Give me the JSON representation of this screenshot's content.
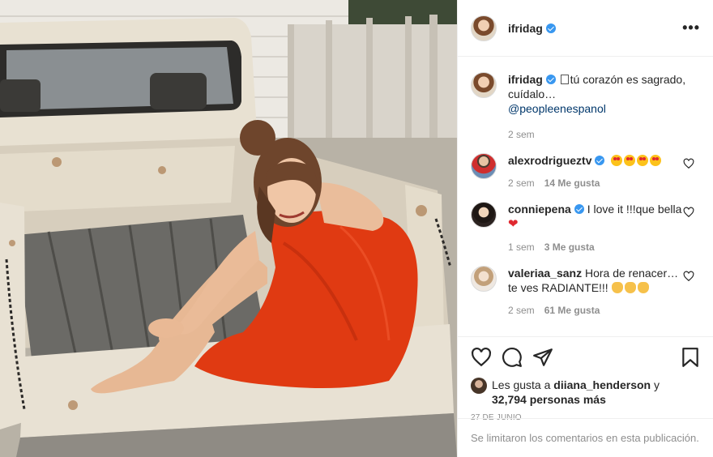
{
  "post": {
    "author": "ifridag",
    "author_verified": true,
    "more_icon": "more-horizontal-icon"
  },
  "caption": {
    "username": "ifridag",
    "text": "tú corazón es sagrado, cuídalo…",
    "mention": "@peopleenespanol",
    "time": "2 sem"
  },
  "comments": [
    {
      "username": "alexrodrigueztv",
      "verified": true,
      "text": "",
      "emoji": "star-struck x4",
      "time": "2 sem",
      "likes": "14 Me gusta"
    },
    {
      "username": "conniepena",
      "verified": true,
      "text": "I love it !!!que bella",
      "emoji": "red-heart",
      "time": "1 sem",
      "likes": "3 Me gusta"
    },
    {
      "username": "valeriaa_sanz",
      "verified": false,
      "text": "Hora de renacer… te ves RADIANTE!!!",
      "emoji": "clapping-hands x3",
      "time": "2 sem",
      "likes": "61 Me gusta"
    }
  ],
  "actions": {
    "like_icon": "heart-icon",
    "comment_icon": "comment-icon",
    "share_icon": "share-icon",
    "save_icon": "bookmark-icon"
  },
  "likes": {
    "prefix": "Les gusta a",
    "user": "diiana_henderson",
    "joiner": "y",
    "others": "32,794 personas más"
  },
  "date": "27 DE JUNIO",
  "comments_limited": "Se limitaron los comentarios en esta publicación.",
  "colors": {
    "link": "#00376b",
    "verified": "#3897f0",
    "muted": "#8e8e8e",
    "dress": "#e03a12"
  }
}
